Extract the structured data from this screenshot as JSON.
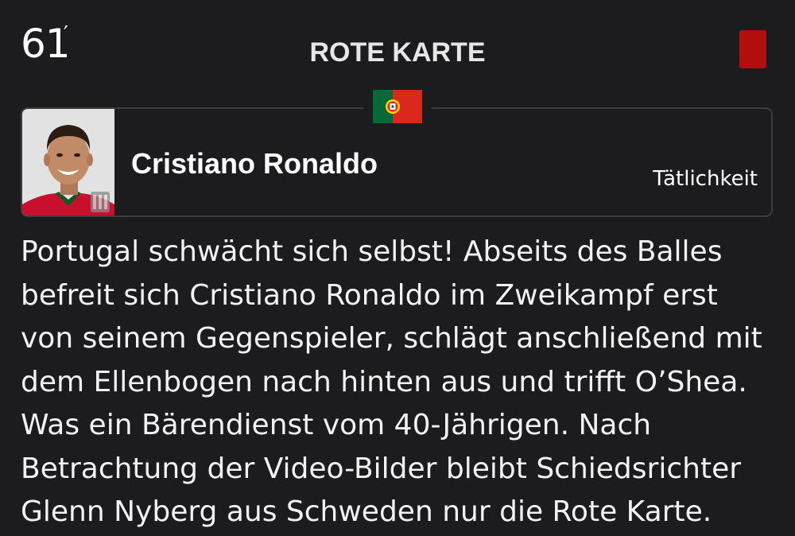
{
  "event": {
    "minute": "61",
    "minute_mark": "′",
    "title": "ROTE KARTE",
    "card_icon": "red-card-icon",
    "card_color": "#b30e0e"
  },
  "player": {
    "team_flag": "portugal-flag-icon",
    "name": "Cristiano Ronaldo",
    "reason": "Tätlichkeit"
  },
  "report": {
    "text": "Portugal schwächt sich selbst! Abseits des Balles\nbefreit sich Cristiano Ronaldo im Zweikampf erst\nvon seinem Gegenspieler, schlägt anschließend mit\ndem Ellenbogen nach hinten aus und trifft O’Shea.\nWas ein Bärendienst vom 40-Jährigen. Nach\nBetrachtung der Video-Bilder bleibt Schiedsrichter\nGlenn Nyberg aus Schweden nur die Rote Karte."
  },
  "colors": {
    "background": "#1c1c1e",
    "card_border": "#3d3d40",
    "text": "#ffffff",
    "flag_green": "#046a38",
    "flag_red": "#da291c"
  }
}
